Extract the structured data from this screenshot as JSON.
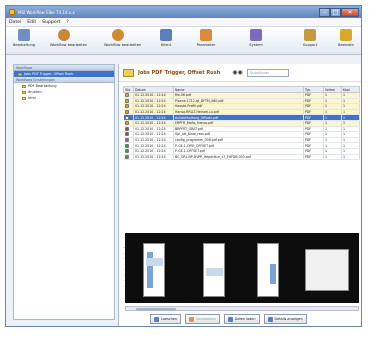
{
  "window": {
    "title": "MSI Workflow Elbe 74.14.x.x",
    "controls": [
      "–",
      "□",
      "✕"
    ]
  },
  "menu": [
    "Datei",
    "Edit",
    "Support",
    "?"
  ],
  "toolbar": [
    {
      "label": "Bearbeitung",
      "icon": "gear-icon",
      "color": "#6d8fc2"
    },
    {
      "label": "Workflow bearbeiten",
      "icon": "tools-icon",
      "color": "#c8873b"
    },
    {
      "label": "Workflow bearbeiten",
      "icon": "workflow-icon",
      "color": "#d18a2f"
    },
    {
      "label": "Klient",
      "icon": "client-icon",
      "color": "#5b7fbc"
    },
    {
      "label": "Parameter",
      "icon": "parameter-icon",
      "color": "#d88b3c"
    },
    {
      "label": "System",
      "icon": "system-icon",
      "color": "#7b6bbd"
    },
    {
      "label": "Support",
      "icon": "support-icon",
      "color": "#c59a3e"
    },
    {
      "label": "Beenden",
      "icon": "exit-icon",
      "color": "#d8a72e"
    }
  ],
  "sidebar": {
    "header1": "Workflows",
    "header2": "Workflows Einstellungen",
    "items": [
      {
        "label": "Jobs PDF Trigger, Offset Rush",
        "selected": true
      },
      {
        "label": "PDF Bearbeitung",
        "selected": false
      },
      {
        "label": "drucken",
        "selected": false
      },
      {
        "label": "html",
        "selected": false
      }
    ]
  },
  "main": {
    "title": "Jobs PDF Trigger, Offset Rush",
    "search_placeholder": "Quickfinder",
    "columns": [
      "Sta",
      "Datum",
      "Name",
      "Typ",
      "Seiten",
      "Kopi"
    ],
    "rows": [
      {
        "status": "#e0a127",
        "date": "01.12.2010 - 12:24",
        "name": "file.06.pdf",
        "type": "PDF",
        "pages": "1",
        "copies": "1",
        "kind": "hl"
      },
      {
        "status": "#e0a127",
        "date": "01.12.2010 - 12:24",
        "name": "Plaene.1712.qt_DFTM_080.pdf",
        "type": "PDF",
        "pages": "1",
        "copies": "1",
        "kind": "hl"
      },
      {
        "status": "#e0a127",
        "date": "01.12.2010 - 12:24",
        "name": "Haeste-Prefill.pdf",
        "type": "PDF",
        "pages": "1",
        "copies": "1",
        "kind": "hl"
      },
      {
        "status": "#e0a127",
        "date": "01.12.2010 - 12:24",
        "name": "Hansa-RRLLT-Heinzel-Lo.pdf",
        "type": "PDF",
        "pages": "1",
        "copies": "1",
        "kind": "hl"
      },
      {
        "status": "#ffffff",
        "date": "01.12.2010 - 12:24",
        "name": "Aufstellhaltung_Offsatz.pdf",
        "type": "PDF",
        "pages": "1",
        "copies": "1",
        "kind": "sel"
      },
      {
        "status": "#e0a127",
        "date": "01.12.2010 - 12:24",
        "name": "ERPFR_Mofla_Hansa.pdf",
        "type": "PDF",
        "pages": "1",
        "copies": "1",
        "kind": "hl"
      },
      {
        "status": "#c23b3b",
        "date": "01.12.2010 - 12:24",
        "name": "BRPFRT_GRAT.pdf",
        "type": "PDF",
        "pages": "1",
        "copies": "1",
        "kind": "plain"
      },
      {
        "status": "#c23b3b",
        "date": "01.12.2010 - 12:24",
        "name": "Spr_ott_Kiste_ress.pdf",
        "type": "PDF",
        "pages": "1",
        "copies": "1",
        "kind": "plain"
      },
      {
        "status": "#b04da8",
        "date": "01.12.2010 - 12:24",
        "name": "config_programm_008.pdf.pdf",
        "type": "PDF",
        "pages": "1",
        "copies": "1",
        "kind": "plain"
      },
      {
        "status": "#3c9b45",
        "date": "01.12.2010 - 12:24",
        "name": "P-GE-1-OPEI_OFFSET.pdf",
        "type": "PDF",
        "pages": "1",
        "copies": "1",
        "kind": "plain"
      },
      {
        "status": "#3c9b45",
        "date": "01.12.2010 - 12:24",
        "name": "P-GE-1-OFFSET.pdf",
        "type": "PDF",
        "pages": "1",
        "copies": "1",
        "kind": "plain"
      },
      {
        "status": "#3c9b45",
        "date": "01.12.2010 - 12:24",
        "name": "BC_GRL.NP-DVPR_Reparatur_s7_FHFDB.003.pdf",
        "type": "PDF",
        "pages": "1",
        "copies": "1",
        "kind": "plain"
      }
    ]
  },
  "footer": [
    {
      "label": "Loeschen",
      "disabled": false,
      "color": "#5b7fbc"
    },
    {
      "label": "Verarbeiten",
      "disabled": true,
      "color": "#c8a14a"
    },
    {
      "label": "Daten laden",
      "disabled": false,
      "color": "#5b7fbc"
    },
    {
      "label": "Details anzeigen",
      "disabled": false,
      "color": "#5b7fbc"
    }
  ]
}
